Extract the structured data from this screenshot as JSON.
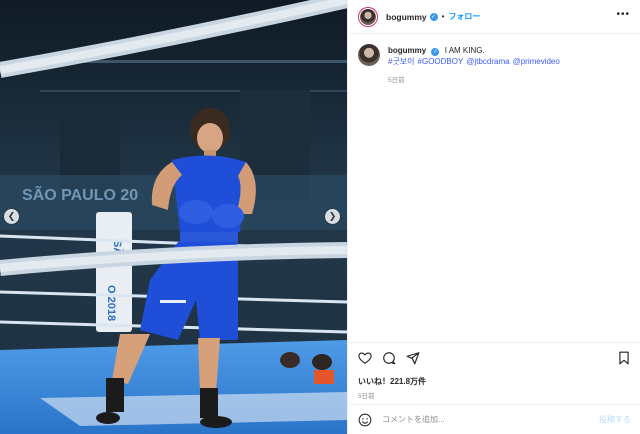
{
  "post": {
    "username": "bogummy",
    "follow_label": "フォロー",
    "separator": "•",
    "more_label": "•••",
    "caption": {
      "username": "bogummy",
      "text": "I AM KING.",
      "tags": [
        "#굿보이",
        "#GOODBOY",
        "@jtbcdrama",
        "@primevideo"
      ],
      "time": "5日前"
    },
    "likes_label": "いいね！221.8万件",
    "time": "5日前"
  },
  "comment": {
    "placeholder": "コメントを追加...",
    "post_label": "投稿する"
  },
  "media": {
    "arena_text": "SÃO PAULO 20",
    "post_text": "SÃO",
    "post_text2": "O 2018"
  },
  "icons": {
    "prev": "chevron-left-icon",
    "next": "chevron-right-icon",
    "like": "heart-icon",
    "comment": "comment-icon",
    "share": "send-icon",
    "save": "bookmark-icon",
    "emoji": "smiley-icon",
    "verified": "verified-badge-icon"
  },
  "colors": {
    "link": "#0095f6",
    "tag": "#3d5afe",
    "verified": "#3897f0",
    "ring_floor": "#2f7fd6",
    "boxer_blue": "#1f4fd8"
  }
}
